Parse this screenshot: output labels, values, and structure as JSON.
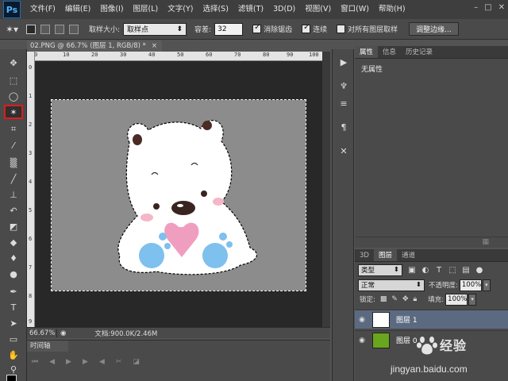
{
  "app": {
    "logo": "Ps"
  },
  "menu": [
    "文件(F)",
    "编辑(E)",
    "图像(I)",
    "图层(L)",
    "文字(Y)",
    "选择(S)",
    "滤镜(T)",
    "3D(D)",
    "视图(V)",
    "窗口(W)",
    "帮助(H)"
  ],
  "options": {
    "sample_size_label": "取样大小:",
    "sample_size_value": "取样点",
    "tolerance_label": "容差:",
    "tolerance_value": "32",
    "antialias_label": "消除锯齿",
    "contiguous_label": "连续",
    "all_layers_label": "对所有图层取样",
    "refine_edge_label": "调整边缘..."
  },
  "document": {
    "tab_title": "02.PNG @ 66.7% (图层 1, RGB/8) *",
    "close": "×",
    "ruler_h": [
      "0",
      "10",
      "20",
      "30",
      "40",
      "50",
      "60",
      "70",
      "80",
      "90",
      "100"
    ],
    "ruler_v": [
      "0",
      "1",
      "2",
      "3",
      "4",
      "5",
      "6",
      "7",
      "8",
      "9"
    ]
  },
  "status": {
    "zoom": "66.67%",
    "doc_info": "文档:900.0K/2.46M"
  },
  "timeline": {
    "tab": "时间轴"
  },
  "properties": {
    "tabs": [
      "属性",
      "信息",
      "历史记录"
    ],
    "body": "无属性"
  },
  "layers": {
    "tabs": [
      "3D",
      "图层",
      "通道"
    ],
    "kind": "类型",
    "blend_mode": "正常",
    "opacity_label": "不透明度:",
    "opacity_value": "100%",
    "lock_label": "锁定:",
    "fill_label": "填充:",
    "fill_value": "100%",
    "items": [
      {
        "name": "图层 1",
        "selected": true,
        "thumb_color": "#ffffff"
      },
      {
        "name": "图层 0",
        "selected": false,
        "thumb_color": "#6aa51e"
      }
    ]
  },
  "watermark": {
    "brand": "经验",
    "url": "jingyan.baidu.com"
  },
  "colors": {
    "menubar": "#3e3e3e",
    "panel": "#4a4a4a",
    "canvas_bg": "#282828",
    "image_bg": "#8c8c8c",
    "highlight": "#e21a1a",
    "selected_layer": "#5b6a80"
  }
}
